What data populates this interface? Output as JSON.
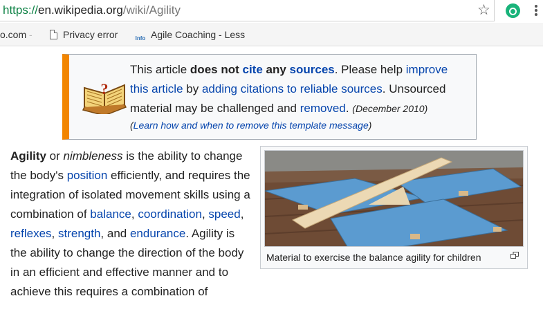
{
  "browser": {
    "url_scheme": "https://",
    "url_host": "en.wikipedia.org",
    "url_path": "/wiki/Agility",
    "bookmarks": [
      {
        "label": "o.com",
        "trail": " -"
      },
      {
        "label": "Privacy error"
      },
      {
        "label": "Agile Coaching - Less",
        "icon_text": "Info"
      }
    ]
  },
  "notice": {
    "p1": "This article ",
    "p2": "does not ",
    "p3": "cite",
    "p4": " any ",
    "p5": "sources",
    "p6": ". Please help ",
    "p7": "improve this article",
    "p8": " by ",
    "p9": "adding citations to reliable sources",
    "p10": ". Unsourced material may be challenged and ",
    "p11": "removed",
    "p12": ". ",
    "date": "(December 2010)",
    "sub_open": "(",
    "sub_link": "Learn how and when to remove this template message",
    "sub_close": ")"
  },
  "article": {
    "t1": "Agility",
    "t2": " or ",
    "t3": "nimbleness",
    "t4": " is the ability to change the body's ",
    "l_position": "position",
    "t5": " efficiently, and requires the integration of isolated movement skills using a combination of ",
    "l_balance": "balance",
    "c1": ", ",
    "l_coordination": "coordination",
    "c2": ", ",
    "l_speed": "speed",
    "c3": ", ",
    "l_reflexes": "reflexes",
    "c4": ", ",
    "l_strength": "strength",
    "t6": ", and ",
    "l_endurance": "endurance",
    "t7": ". Agility is the ability to change the direction of the body in an efficient and effective manner and to achieve this requires a combination of"
  },
  "figure": {
    "caption": "Material to exercise the balance agility for children"
  },
  "colors": {
    "link": "#0645ad",
    "notice_bar": "#f28500",
    "url_secure": "#0b8043"
  }
}
